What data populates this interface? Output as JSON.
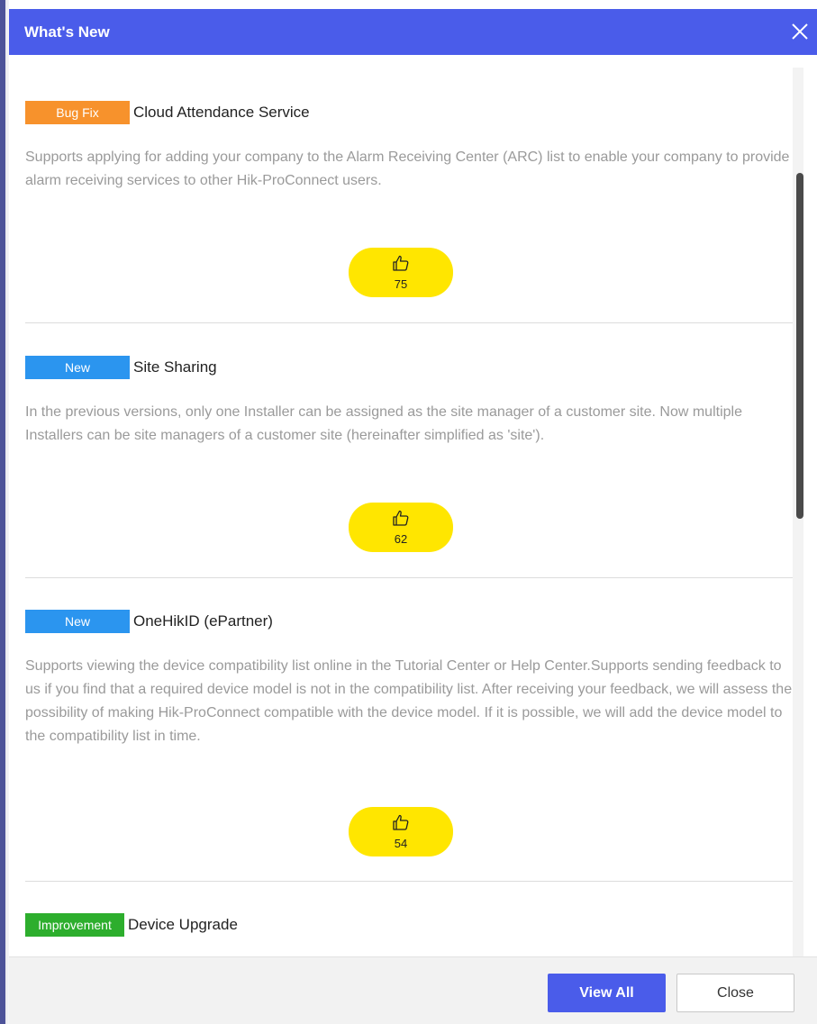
{
  "dialog": {
    "title": "What's New",
    "close_icon": "close-icon"
  },
  "items": [
    {
      "tag": "Bug Fix",
      "tag_color": "#f7922c",
      "title": "Cloud Attendance Service",
      "description": "Supports applying for adding your company to the Alarm Receiving Center (ARC) list to enable your company to provide alarm receiving services to other Hik-ProConnect users.",
      "likes": "75",
      "like_icon": "thumbs-up-icon"
    },
    {
      "tag": "New",
      "tag_color": "#2b95ef",
      "title": "Site Sharing",
      "description": "In the previous versions, only one Installer can be assigned as the site manager of a customer site. Now multiple Installers can be site managers of a customer site (hereinafter simplified as 'site').",
      "likes": "62",
      "like_icon": "thumbs-up-icon"
    },
    {
      "tag": "New",
      "tag_color": "#2b95ef",
      "title": "OneHikID (ePartner)",
      "description": "Supports viewing the device compatibility list online in the Tutorial Center or Help Center.Supports sending feedback to us if you find that a required device model is not in the compatibility list. After receiving your feedback, we will assess the possibility of making Hik-ProConnect compatible with the device model. If it is possible, we will add the device model to the compatibility list in time.",
      "likes": "54",
      "like_icon": "thumbs-up-icon"
    },
    {
      "tag": "Improvement",
      "tag_color": "#2dae2d",
      "title": "Device Upgrade"
    }
  ],
  "footer": {
    "view_all_label": "View All",
    "close_label": "Close"
  },
  "colors": {
    "accent": "#4a5cea",
    "like_button": "#ffe600"
  }
}
